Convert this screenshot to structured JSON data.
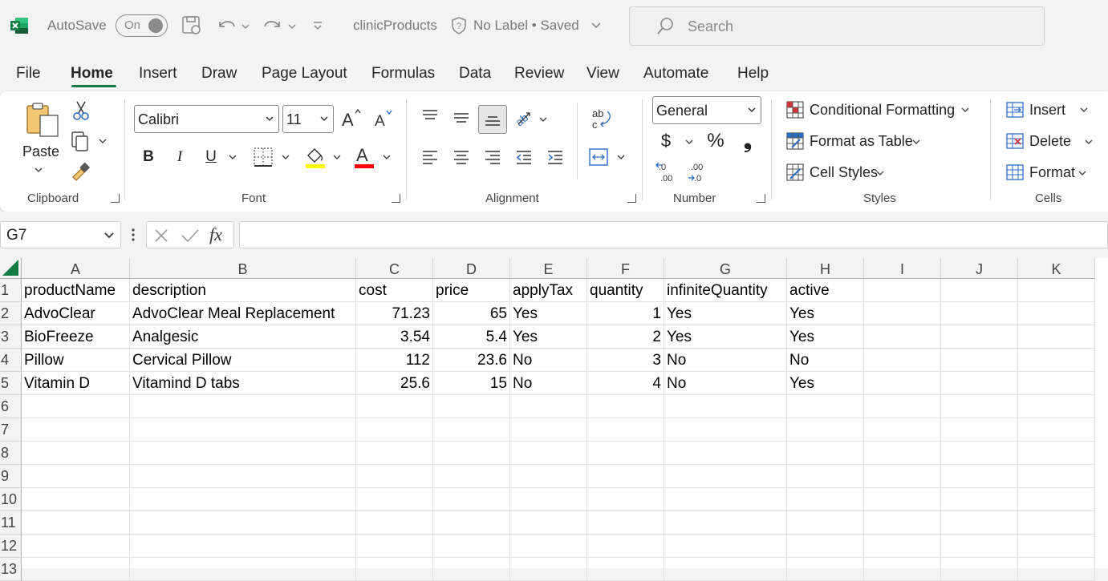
{
  "titlebar": {
    "autosave_label": "AutoSave",
    "toggle_state": "On",
    "filename": "clinicProducts",
    "label_status": "No Label • Saved",
    "search_placeholder": "Search"
  },
  "menu": {
    "items": [
      "File",
      "Home",
      "Insert",
      "Draw",
      "Page Layout",
      "Formulas",
      "Data",
      "Review",
      "View",
      "Automate",
      "Help"
    ],
    "active": "Home"
  },
  "ribbon": {
    "clipboard": {
      "paste_label": "Paste",
      "group_label": "Clipboard"
    },
    "font": {
      "font_name": "Calibri",
      "font_size": "11",
      "group_label": "Font",
      "bold": "B",
      "italic": "I",
      "underline": "U"
    },
    "alignment": {
      "group_label": "Alignment"
    },
    "number": {
      "format": "General",
      "currency": "$",
      "percent": "%",
      "comma": "❟",
      "group_label": "Number"
    },
    "styles": {
      "conditional_formatting": "Conditional Formatting",
      "format_as_table": "Format as Table",
      "cell_styles": "Cell Styles",
      "group_label": "Styles"
    },
    "cells": {
      "insert": "Insert",
      "delete": "Delete",
      "format": "Format",
      "group_label": "Cells"
    }
  },
  "formula_bar": {
    "name_box": "G7",
    "fx": "fx",
    "formula": ""
  },
  "sheet": {
    "columns": [
      "A",
      "B",
      "C",
      "D",
      "E",
      "F",
      "G",
      "H",
      "I",
      "J",
      "K"
    ],
    "row_numbers": [
      "1",
      "2",
      "3",
      "4",
      "5",
      "6",
      "7",
      "8",
      "9",
      "10",
      "11",
      "12",
      "13"
    ],
    "rows": [
      [
        "productName",
        "description",
        "cost",
        "price",
        "applyTax",
        "quantity",
        "infiniteQuantity",
        "active"
      ],
      [
        "AdvoClear",
        "AdvoClear Meal Replacement",
        "71.23",
        "65",
        "Yes",
        "1",
        "Yes",
        "Yes"
      ],
      [
        "BioFreeze",
        "Analgesic",
        "3.54",
        "5.4",
        "Yes",
        "2",
        "Yes",
        "Yes"
      ],
      [
        "Pillow",
        "Cervical Pillow",
        "112",
        "23.6",
        "No",
        "3",
        "No",
        "No"
      ],
      [
        "Vitamin D",
        "Vitamind D tabs",
        "25.6",
        "15",
        "No",
        "4",
        "No",
        "Yes"
      ]
    ]
  },
  "colors": {
    "excel_green": "#107c41",
    "highlight_yellow": "#ffff00",
    "font_red": "#ff0000"
  }
}
